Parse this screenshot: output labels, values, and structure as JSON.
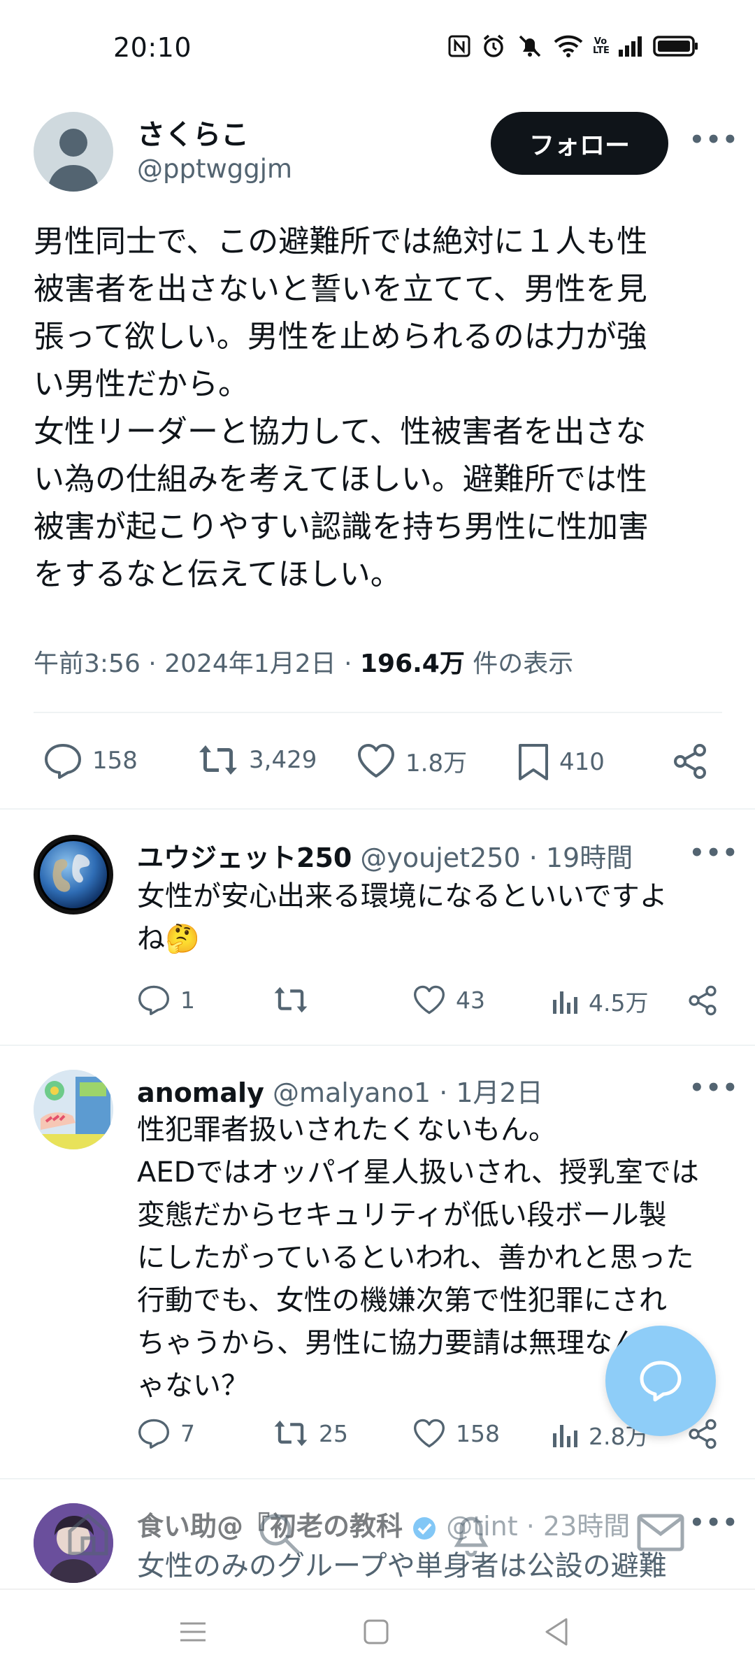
{
  "status_bar": {
    "time": "20:10",
    "icons": [
      "nfc-icon",
      "alarm-icon",
      "mute-icon",
      "wifi-icon",
      "volte-icon",
      "signal-icon",
      "battery-icon"
    ],
    "volte_label": "Vo LTE"
  },
  "tweet": {
    "author_name": "さくらこ",
    "author_handle": "@pptwggjm",
    "follow_label": "フォロー",
    "body": "男性同士で、この避難所では絶対に１人も性\n被害者を出さないと誓いを立てて、男性を見\n張って欲しい。男性を止められるのは力が強\nい男性だから。\n女性リーダーと協力して、性被害者を出さな\nい為の仕組みを考えてほしい。避難所では性\n被害が起こりやすい認識を持ち男性に性加害\nをするなと伝えてほしい。",
    "time": "午前3:56",
    "date": "2024年1月2日",
    "views": "196.4万",
    "views_label": "件の表示",
    "stats": {
      "replies": "158",
      "retweets": "3,429",
      "likes": "1.8万",
      "bookmarks": "410"
    }
  },
  "replies": [
    {
      "name": "ユウジェット250",
      "handle": "@youjet250",
      "time": "19時間",
      "text": "女性が安心出来る環境になるといいですよ\nね🤔",
      "replies": "1",
      "retweets": "",
      "likes": "43",
      "views": "4.5万"
    },
    {
      "name": "anomaly",
      "handle": "@malyano1",
      "time": "1月2日",
      "text": "性犯罪者扱いされたくないもん。\nAEDではオッパイ星人扱いされ、授乳室では\n変態だからセキュリティが低い段ボール製\nにしたがっているといわれ、善かれと思った\n行動でも、女性の機嫌次第で性犯罪にされ\nちゃうから、男性に協力要請は無理なんじ\nゃない？",
      "replies": "7",
      "retweets": "25",
      "likes": "158",
      "views": "2.8万"
    },
    {
      "name": "食い助@『初老の教科",
      "handle": "@tint",
      "time": "23時間",
      "text": "女性のみのグループや単身者は公設の避難"
    }
  ],
  "colors": {
    "text": "#0f1419",
    "secondary": "#536471",
    "follow_bg": "#0f1419",
    "fab": "#8ecdf8",
    "verified": "#1d9bf0"
  }
}
